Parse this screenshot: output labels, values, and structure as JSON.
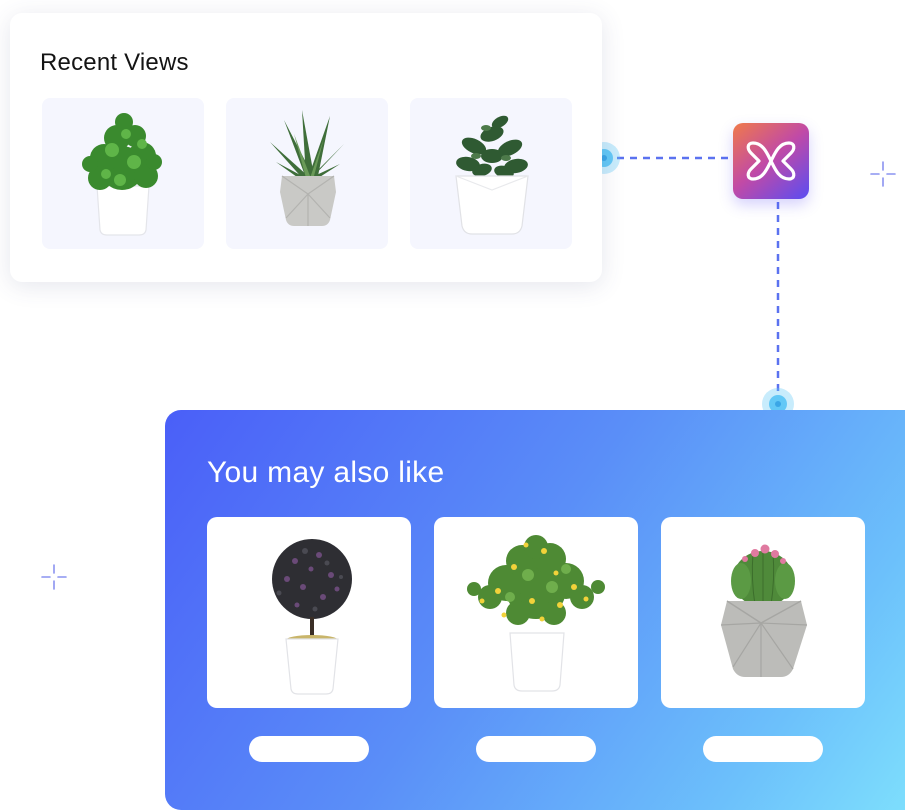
{
  "recent_views": {
    "title": "Recent Views",
    "items": [
      {
        "product": "leafy-green-plant-white-pot"
      },
      {
        "product": "aloe-plant-grey-geometric-pot"
      },
      {
        "product": "jade-plant-white-square-pot"
      }
    ]
  },
  "recommendations": {
    "title": "You may also like",
    "items": [
      {
        "product": "topiary-ball-white-pot"
      },
      {
        "product": "flowering-shrub-white-pot"
      },
      {
        "product": "cactus-grey-concrete-pot"
      }
    ]
  },
  "brand": {
    "icon": "bow-logo-icon",
    "gradient": [
      "#f07a4a",
      "#c14aa6",
      "#5a4df2"
    ]
  },
  "colors": {
    "accent_blue": "#4a5ff8",
    "accent_cyan": "#7fe1fd",
    "connector": "#5b72f0",
    "node": "#62c8f6",
    "tile_bg": "#f5f6fe"
  }
}
